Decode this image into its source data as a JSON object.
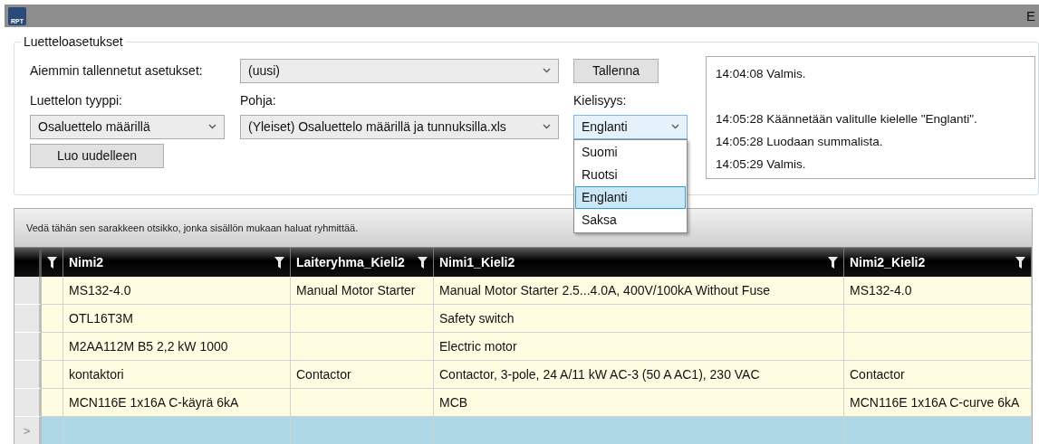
{
  "window": {
    "logo": "RPT",
    "title": "E"
  },
  "settings": {
    "title": "Luetteloasetukset",
    "saved_label": "Aiemmin tallennetut asetukset:",
    "saved_value": "(uusi)",
    "save_button": "Tallenna",
    "type_label": "Luettelon tyyppi:",
    "type_value": "Osaluettelo määrillä",
    "template_label": "Pohja:",
    "template_value": "(Yleiset) Osaluettelo määrillä ja tunnuksilla.xls",
    "language_label": "Kielisyys:",
    "language_value": "Englanti",
    "language_expanded": true,
    "language_options": [
      {
        "label": "Suomi",
        "selected": false
      },
      {
        "label": "Ruotsi",
        "selected": false
      },
      {
        "label": "Englanti",
        "selected": true
      },
      {
        "label": "Saksa",
        "selected": false
      }
    ],
    "regenerate_button": "Luo uudelleen"
  },
  "log": {
    "paragraphs": [
      [
        "14:04:08 Valmis."
      ],
      [
        "14:05:28 Käännetään valitulle kielelle \"Englanti\".",
        "14:05:28 Luodaan summalista.",
        "14:05:29 Valmis."
      ]
    ]
  },
  "grid": {
    "group_hint": "Vedä tähän sen sarakkeen otsikko, jonka sisällön mukaan haluat ryhmittää.",
    "columns": [
      {
        "label": "Nimi2"
      },
      {
        "label": "Laiteryhma_Kieli2"
      },
      {
        "label": "Nimi1_Kieli2"
      },
      {
        "label": "Nimi2_Kieli2"
      }
    ],
    "rows": [
      {
        "cells": [
          "MS132-4.0",
          "Manual Motor  Starter",
          "Manual Motor  Starter 2.5...4.0A, 400V/100kA Without Fuse",
          "MS132-4.0"
        ]
      },
      {
        "cells": [
          "OTL16T3M",
          null,
          "Safety switch",
          null
        ]
      },
      {
        "cells": [
          "M2AA112M B5 2,2 kW 1000",
          null,
          "Electric motor",
          null
        ]
      },
      {
        "cells": [
          "kontaktori",
          "Contactor",
          "Contactor, 3-pole, 24 A/11 kW AC-3 (50 A AC1), 230 VAC",
          "Contactor"
        ]
      },
      {
        "cells": [
          "MCN116E 1x16A C-käyrä 6kA",
          null,
          "MCB",
          "MCN116E 1x16A C-curve 6kA"
        ]
      }
    ],
    "new_row": {
      "indicator": ">"
    }
  }
}
